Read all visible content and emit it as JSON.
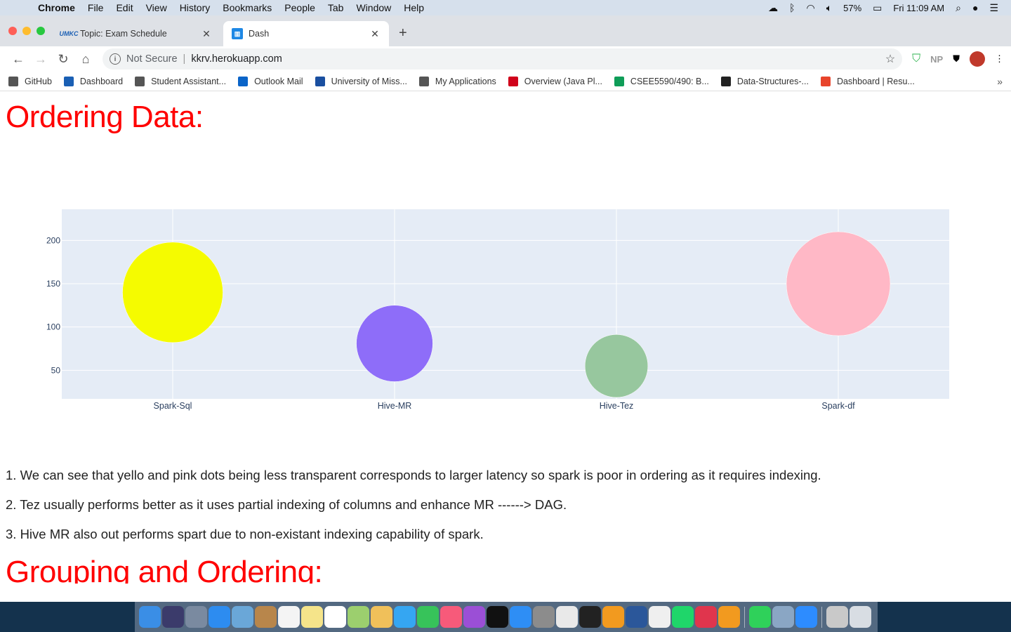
{
  "menubar": {
    "app": "Chrome",
    "items": [
      "File",
      "Edit",
      "View",
      "History",
      "Bookmarks",
      "People",
      "Tab",
      "Window",
      "Help"
    ],
    "battery": "57%",
    "clock": "Fri 11:09 AM"
  },
  "tabs": [
    {
      "title": "Topic: Exam Schedule",
      "active": false
    },
    {
      "title": "Dash",
      "active": true
    }
  ],
  "address": {
    "security": "Not Secure",
    "url": "kkrv.herokuapp.com"
  },
  "extensions": {
    "np": "NP"
  },
  "bookmarks": [
    {
      "label": "GitHub",
      "color": "#555555"
    },
    {
      "label": "Dashboard",
      "color": "#1a5fb4"
    },
    {
      "label": "Student Assistant...",
      "color": "#555555"
    },
    {
      "label": "Outlook Mail",
      "color": "#0a64c8"
    },
    {
      "label": "University of Miss...",
      "color": "#1a4fa0"
    },
    {
      "label": "My Applications",
      "color": "#555555"
    },
    {
      "label": "Overview (Java Pl...",
      "color": "#d0021b"
    },
    {
      "label": "CSEE5590/490: B...",
      "color": "#0f9d58"
    },
    {
      "label": "Data-Structures-...",
      "color": "#222222"
    },
    {
      "label": "Dashboard | Resu...",
      "color": "#e8442b"
    }
  ],
  "page": {
    "heading1": "Ordering Data:",
    "notes": [
      "1. We can see that yello and pink dots being less transparent corresponds to larger latency so spark is poor in ordering as it requires indexing.",
      "2. Tez usually performs better as it uses partial indexing of columns and enhance MR ------> DAG.",
      "3. Hive MR also out performs spart due to non-existant indexing capability of spark."
    ],
    "heading2": "Grouping and Ordering:"
  },
  "chart_data": {
    "type": "scatter",
    "categories": [
      "Spark-Sql",
      "Hive-MR",
      "Hive-Tez",
      "Spark-df"
    ],
    "values": [
      140,
      81,
      55,
      150
    ],
    "sizes": [
      140,
      81,
      55,
      150
    ],
    "colors": [
      "#f5fb00",
      "#8e6df9",
      "#97c79e",
      "#ffb8c6"
    ],
    "yticks": [
      50,
      100,
      150,
      200
    ],
    "ylim": [
      17,
      236
    ],
    "grid": true
  }
}
